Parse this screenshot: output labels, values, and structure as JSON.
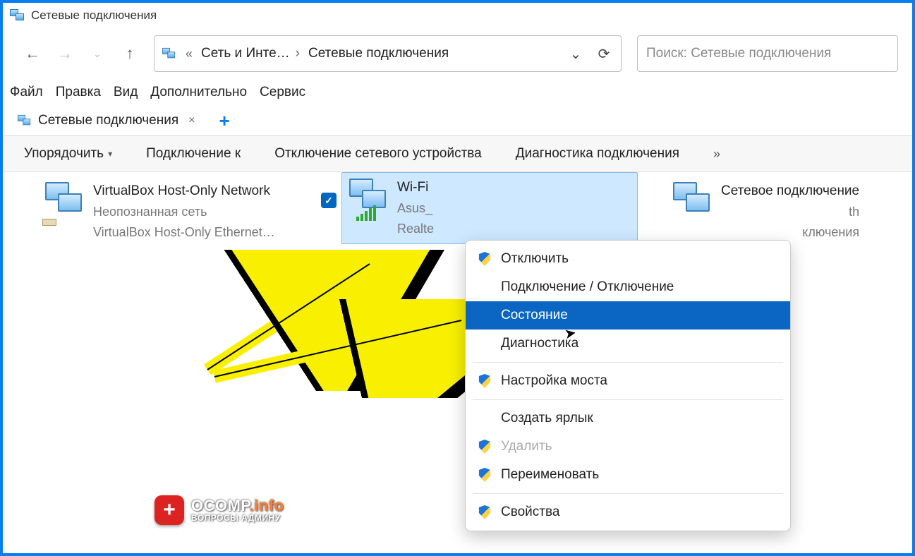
{
  "window": {
    "title": "Сетевые подключения"
  },
  "address": {
    "crumb1": "Сеть и Инте…",
    "crumb2": "Сетевые подключения"
  },
  "search": {
    "placeholder": "Поиск: Сетевые подключения"
  },
  "menubar": {
    "file": "Файл",
    "edit": "Правка",
    "view": "Вид",
    "extra": "Дополнительно",
    "service": "Сервис"
  },
  "tab": {
    "label": "Сетевые подключения"
  },
  "toolbar": {
    "organize": "Упорядочить",
    "connect_to": "Подключение к",
    "disable_device": "Отключение сетевого устройства",
    "diagnostics": "Диагностика подключения",
    "overflow": "»"
  },
  "connections": {
    "vb": {
      "name": "VirtualBox Host-Only Network",
      "status": "Неопознанная сеть",
      "adapter": "VirtualBox Host-Only Ethernet…"
    },
    "wifi": {
      "name": "Wi-Fi",
      "status": "Asus_",
      "adapter": "Realte"
    },
    "bt": {
      "name": "Сетевое подключение",
      "status_suffix": "th",
      "adapter_suffix": "ключения"
    }
  },
  "context_menu": {
    "disable": "Отключить",
    "connect_disconnect": "Подключение / Отключение",
    "status": "Состояние",
    "diagnostics": "Диагностика",
    "bridge": "Настройка моста",
    "create_shortcut": "Создать ярлык",
    "delete": "Удалить",
    "rename": "Переименовать",
    "properties": "Свойства"
  },
  "watermark": {
    "badge": "+",
    "brand_main": "OCOMP",
    "brand_suffix": ".info",
    "subtitle": "ВОПРОСЫ АДМИНУ"
  }
}
